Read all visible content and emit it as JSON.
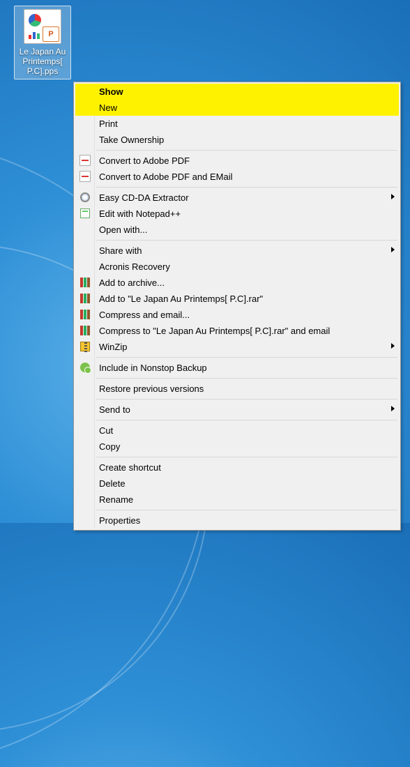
{
  "file": {
    "label": "Le Japan Au Printemps[ P.C].pps"
  },
  "menu": {
    "show": "Show",
    "new": "New",
    "print": "Print",
    "take_ownership": "Take Ownership",
    "convert_pdf": "Convert to Adobe PDF",
    "convert_pdf_email": "Convert to Adobe PDF and EMail",
    "easy_cd": "Easy CD-DA Extractor",
    "edit_notepad": "Edit with Notepad++",
    "open_with": "Open with...",
    "share_with": "Share with",
    "acronis": "Acronis Recovery",
    "add_archive": "Add to archive...",
    "add_to_rar": "Add to \"Le Japan Au Printemps[ P.C].rar\"",
    "compress_email": "Compress and email...",
    "compress_to_rar_email": "Compress to \"Le Japan Au Printemps[ P.C].rar\" and email",
    "winzip": "WinZip",
    "nonstop_backup": "Include in Nonstop Backup",
    "restore_prev": "Restore previous versions",
    "send_to": "Send to",
    "cut": "Cut",
    "copy": "Copy",
    "create_shortcut": "Create shortcut",
    "delete": "Delete",
    "rename": "Rename",
    "properties": "Properties"
  }
}
